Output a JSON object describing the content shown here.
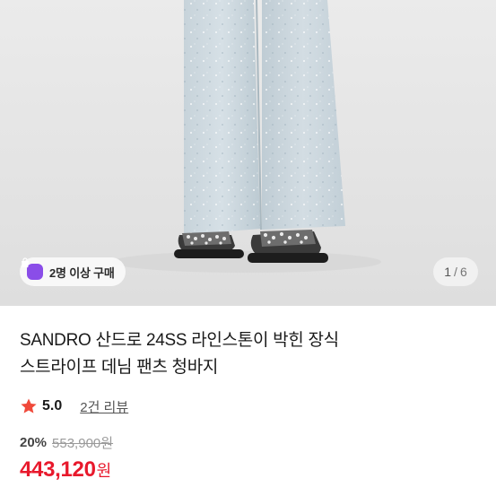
{
  "hero": {
    "buyers_badge": "2명 이상 구매",
    "page_current": "1",
    "page_separator": "/",
    "page_total": "6"
  },
  "product": {
    "title_line1": "SANDRO 산드로 24SS 라인스톤이 박힌 장식",
    "title_line2": "스트라이프 데님 팬츠 청바지",
    "rating": "5.0",
    "reviews_link": "2건 리뷰",
    "discount": "20%",
    "original_price": "553,900원",
    "final_price": "443,120",
    "final_currency": "원"
  },
  "colors": {
    "accent_red": "#e8192c",
    "badge_purple": "#8a4de8",
    "star": "#f0493a"
  },
  "icons": {
    "badge": "shopping-bag-icon",
    "rating": "star-icon"
  }
}
